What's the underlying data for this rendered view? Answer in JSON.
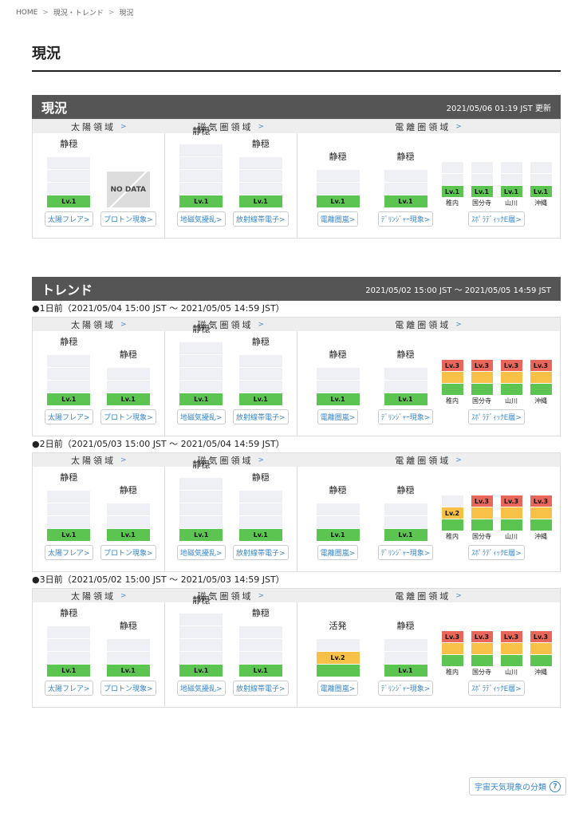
{
  "breadcrumb": [
    "HOME",
    "現況・トレンド",
    "現況"
  ],
  "breadcrumb_sep": ">",
  "page_title": "現況",
  "categories": {
    "solar": "太陽領域",
    "geomag": "磁気圏領域",
    "iono": "電離圏領域",
    "chev": ">"
  },
  "buttons": {
    "flare": "太陽フレア>",
    "proton": "プロトン現象>",
    "geomag": "地磁気擾乱>",
    "radiation": "放射線帯電子>",
    "iono_storm": "電離圏嵐>",
    "dellinger": "ﾃﾞﾘﾝｼﾞｬｰ現象>",
    "es": "ｽﾎﾟﾗﾃﾞｨｯｸE層>"
  },
  "stations": [
    "稚内",
    "国分寺",
    "山川",
    "沖縄"
  ],
  "current": {
    "title": "現況",
    "updated": "2021/05/06 01:19 JST 更新",
    "no_data": "NO DATA",
    "items": [
      {
        "state": "静穏",
        "level": "Lv.1",
        "num": 1,
        "max": 4
      },
      {
        "state": "",
        "level": "",
        "num": 0,
        "max": 3
      },
      {
        "state": "静穏",
        "level": "Lv.1",
        "num": 1,
        "max": 5
      },
      {
        "state": "静穏",
        "level": "Lv.1",
        "num": 1,
        "max": 4
      },
      {
        "state": "静穏",
        "level": "Lv.1",
        "num": 1,
        "max": 3
      },
      {
        "state": "静穏",
        "level": "Lv.1",
        "num": 1,
        "max": 3
      }
    ],
    "es": [
      "Lv.1",
      "Lv.1",
      "Lv.1",
      "Lv.1"
    ],
    "es_num": [
      1,
      1,
      1,
      1
    ]
  },
  "trend": {
    "title": "トレンド",
    "range": "2021/05/02 15:00 JST 〜 2021/05/05 14:59 JST",
    "days": [
      {
        "label": "●1日前（2021/05/04 15:00 JST 〜 2021/05/05 14:59 JST）",
        "items": [
          {
            "state": "静穏",
            "level": "Lv.1",
            "num": 1,
            "max": 4
          },
          {
            "state": "静穏",
            "level": "Lv.1",
            "num": 1,
            "max": 3
          },
          {
            "state": "静穏",
            "level": "Lv.1",
            "num": 1,
            "max": 5
          },
          {
            "state": "静穏",
            "level": "Lv.1",
            "num": 1,
            "max": 4
          },
          {
            "state": "静穏",
            "level": "Lv.1",
            "num": 1,
            "max": 3
          },
          {
            "state": "静穏",
            "level": "Lv.1",
            "num": 1,
            "max": 3
          }
        ],
        "es": [
          "Lv.3",
          "Lv.3",
          "Lv.3",
          "Lv.3"
        ],
        "es_num": [
          3,
          3,
          3,
          3
        ]
      },
      {
        "label": "●2日前（2021/05/03 15:00 JST 〜 2021/05/04 14:59 JST）",
        "items": [
          {
            "state": "静穏",
            "level": "Lv.1",
            "num": 1,
            "max": 4
          },
          {
            "state": "静穏",
            "level": "Lv.1",
            "num": 1,
            "max": 3
          },
          {
            "state": "静穏",
            "level": "Lv.1",
            "num": 1,
            "max": 5
          },
          {
            "state": "静穏",
            "level": "Lv.1",
            "num": 1,
            "max": 4
          },
          {
            "state": "静穏",
            "level": "Lv.1",
            "num": 1,
            "max": 3
          },
          {
            "state": "静穏",
            "level": "Lv.1",
            "num": 1,
            "max": 3
          }
        ],
        "es": [
          "Lv.2",
          "Lv.3",
          "Lv.3",
          "Lv.3"
        ],
        "es_num": [
          2,
          3,
          3,
          3
        ]
      },
      {
        "label": "●3日前（2021/05/02 15:00 JST 〜 2021/05/03 14:59 JST）",
        "items": [
          {
            "state": "静穏",
            "level": "Lv.1",
            "num": 1,
            "max": 4
          },
          {
            "state": "静穏",
            "level": "Lv.1",
            "num": 1,
            "max": 3
          },
          {
            "state": "静穏",
            "level": "Lv.1",
            "num": 1,
            "max": 5
          },
          {
            "state": "静穏",
            "level": "Lv.1",
            "num": 1,
            "max": 4
          },
          {
            "state": "活発",
            "level": "Lv.2",
            "num": 2,
            "max": 3
          },
          {
            "state": "静穏",
            "level": "Lv.1",
            "num": 1,
            "max": 3
          }
        ],
        "es": [
          "Lv.3",
          "Lv.3",
          "Lv.3",
          "Lv.3"
        ],
        "es_num": [
          3,
          3,
          3,
          3
        ]
      }
    ]
  },
  "classify_button": "宇宙天気現象の分類",
  "classify_icon": "?",
  "colors": {
    "lv1": "#5cc552",
    "lv2": "#f6c146",
    "lv3": "#e8665a",
    "header": "#555555",
    "link": "#3a86c8"
  }
}
